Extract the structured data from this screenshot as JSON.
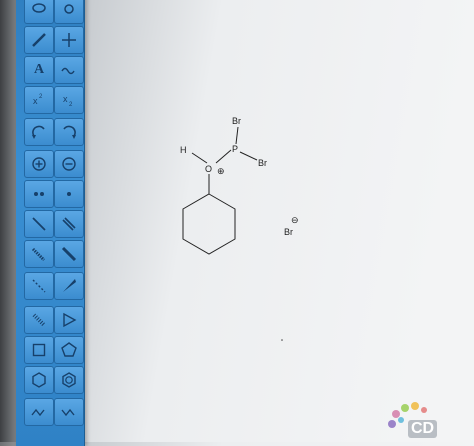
{
  "toolbar": {
    "tools": [
      {
        "icon": "lasso-icon"
      },
      {
        "icon": "eraser-icon"
      },
      {
        "icon": "pencil-icon"
      },
      {
        "icon": "move-icon"
      },
      {
        "icon": "text-icon",
        "label": "A"
      },
      {
        "icon": "wavy-bond-icon"
      },
      {
        "icon": "superscript-icon"
      },
      {
        "icon": "subscript-icon"
      },
      {
        "icon": "arrow-ccw-icon"
      },
      {
        "icon": "arrow-cw-icon"
      },
      {
        "icon": "plus-charge-icon"
      },
      {
        "icon": "minus-charge-icon"
      },
      {
        "icon": "lone-pair-icon"
      },
      {
        "icon": "radical-icon"
      },
      {
        "icon": "single-bond-icon"
      },
      {
        "icon": "double-bond-icon"
      },
      {
        "icon": "hash-bond-icon"
      },
      {
        "icon": "bold-bond-icon"
      },
      {
        "icon": "dashed-bond-icon"
      },
      {
        "icon": "wedge-bond-icon"
      },
      {
        "icon": "hashed-wedge-icon"
      },
      {
        "icon": "triangle-icon"
      },
      {
        "icon": "square-icon"
      },
      {
        "icon": "pentagon-icon"
      },
      {
        "icon": "hexagon-icon"
      },
      {
        "icon": "benzene-icon"
      },
      {
        "icon": "chain-icon"
      },
      {
        "icon": "chain-alt-icon"
      }
    ]
  },
  "molecule": {
    "atoms": {
      "br_top": "Br",
      "h": "H",
      "p": "P",
      "br_right": "Br",
      "o": "O",
      "o_charge": "⊕",
      "br_ion": "Br",
      "br_ion_charge": "⊖"
    }
  },
  "logo": {
    "text": "CD"
  }
}
